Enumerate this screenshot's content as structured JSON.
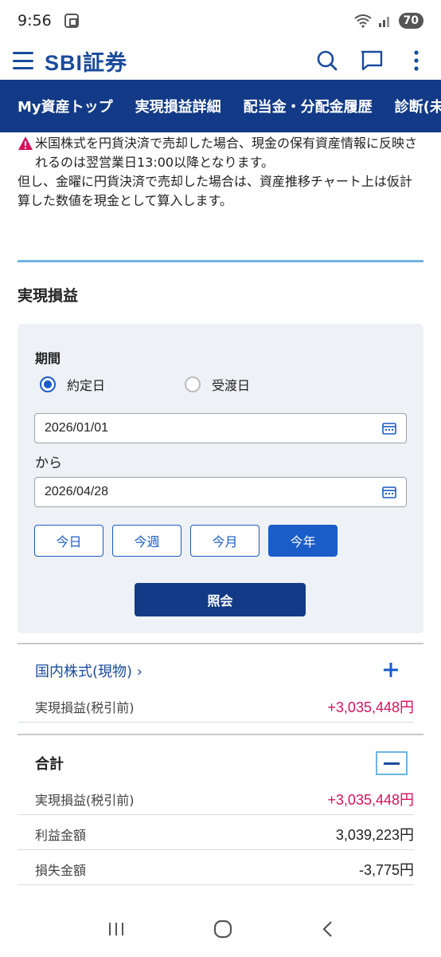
{
  "status_bar": {
    "time": "9:56",
    "battery": "70"
  },
  "header": {
    "logo": "SBI証券"
  },
  "nav_tabs": [
    "My資産トップ",
    "実現損益詳細",
    "配当金・分配金履歴",
    "診断(未"
  ],
  "notice": {
    "line1": "米国株式を円貨決済で売却した場合、現金の保有資産情報に反映されるのは翌営業日13:00以降となります。",
    "line2": "但し、金曜に円貨決済で売却した場合は、資産推移チャート上は仮計算した数値を現金として算入します。"
  },
  "section_title": "実現損益",
  "filter": {
    "period_label": "期間",
    "radio_contract": "約定日",
    "radio_delivery": "受渡日",
    "selected": "約定日",
    "date_from": "2026/01/01",
    "kara": "から",
    "date_to": "2026/04/28",
    "quick_buttons": [
      "今日",
      "今週",
      "今月",
      "今年"
    ],
    "active_quick": "今年",
    "query_label": "照会"
  },
  "domestic": {
    "title": "国内株式(現物) ›",
    "realized_label": "実現損益(税引前)",
    "realized_value": "+3,035,448円"
  },
  "total": {
    "title": "合計",
    "realized_label": "実現損益(税引前)",
    "realized_value": "+3,035,448円",
    "profit_label": "利益金額",
    "profit_value": "3,039,223円",
    "loss_label": "損失金額",
    "loss_value": "-3,775円"
  },
  "colors": {
    "brand": "#123a86",
    "accent": "#1a5cc8",
    "profit": "#d6135c",
    "divider": "#6fb3e0"
  }
}
